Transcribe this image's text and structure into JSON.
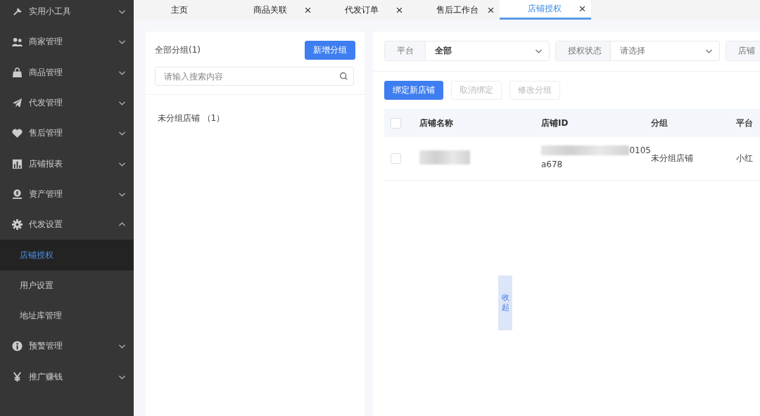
{
  "tabs": [
    {
      "label": "主页",
      "closable": false,
      "selected": false
    },
    {
      "label": "商品关联",
      "closable": true,
      "selected": false
    },
    {
      "label": "代发订单",
      "closable": true,
      "selected": false
    },
    {
      "label": "售后工作台",
      "closable": true,
      "selected": false
    },
    {
      "label": "店铺授权",
      "closable": true,
      "selected": true
    }
  ],
  "sidebar": {
    "items": [
      {
        "label": "实用小工具",
        "expanded": false
      },
      {
        "label": "商家管理",
        "expanded": false
      },
      {
        "label": "商品管理",
        "expanded": false
      },
      {
        "label": "代发管理",
        "expanded": false
      },
      {
        "label": "售后管理",
        "expanded": false
      },
      {
        "label": "店铺报表",
        "expanded": false
      },
      {
        "label": "资产管理",
        "expanded": false
      },
      {
        "label": "代发设置",
        "expanded": true,
        "children": [
          {
            "label": "店铺授权",
            "selected": true
          },
          {
            "label": "用户设置",
            "selected": false
          },
          {
            "label": "地址库管理",
            "selected": false
          }
        ]
      },
      {
        "label": "预警管理",
        "expanded": false
      },
      {
        "label": "推广赚钱",
        "expanded": false
      }
    ]
  },
  "group_panel": {
    "title": "全部分组(1)",
    "add_button": "新增分组",
    "search": {
      "placeholder": "请输入搜索内容"
    },
    "groups": [
      {
        "label": "未分组店铺 （1）",
        "selected": false
      }
    ],
    "collapse_handle": "收起"
  },
  "filters": [
    {
      "label": "平台",
      "value": "全部"
    },
    {
      "label": "授权状态",
      "placeholder": "请选择"
    },
    {
      "label": "店铺"
    }
  ],
  "actions": [
    {
      "label": "绑定新店铺",
      "disabled": false
    },
    {
      "label": "取消绑定",
      "disabled": true
    },
    {
      "label": "修改分组",
      "disabled": true
    }
  ],
  "table": {
    "columns": [
      "店铺名称",
      "店铺ID",
      "分组",
      "平台"
    ],
    "header_checked": false,
    "rows": [
      {
        "checked": false,
        "store_name_redacted": true,
        "store_id_lines": [
          "0105",
          "a678"
        ],
        "group": "未分组店铺",
        "platform": "小红"
      }
    ]
  }
}
